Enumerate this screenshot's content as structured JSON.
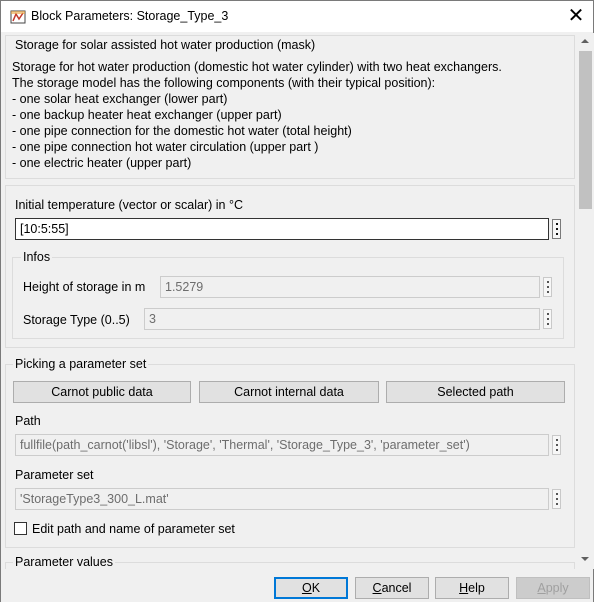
{
  "window": {
    "title": "Block Parameters: Storage_Type_3",
    "close_glyph": "✕"
  },
  "mask": {
    "title": "Storage for solar assisted hot water production (mask)",
    "description": [
      "Storage for hot water production (domestic hot water cylinder) with two heat exchangers.",
      "The storage model has the following components (with their typical position):",
      "- one solar heat exchanger (lower part)",
      "- one backup heater heat exchanger (upper part)",
      "- one pipe connection for the domestic hot water (total height)",
      "- one pipe connection hot water circulation (upper part )",
      "- one electric heater (upper part)"
    ]
  },
  "initial_temperature": {
    "label": "Initial temperature (vector or scalar) in °C",
    "value": "[10:5:55]"
  },
  "infos": {
    "title": "Infos",
    "height_label": "Height of storage in m",
    "height_value": "1.5279",
    "type_label": "Storage Type (0..5)",
    "type_value": "3"
  },
  "picking": {
    "title": "Picking a parameter set",
    "buttons": [
      "Carnot public data",
      "Carnot internal data",
      "Selected path"
    ],
    "path_label": "Path",
    "path_value": "fullfile(path_carnot('libsl'), 'Storage', 'Thermal', 'Storage_Type_3', 'parameter_set')",
    "parameter_set_label": "Parameter set",
    "parameter_set_value": "'StorageType3_300_L.mat'",
    "edit_checkbox_label": "Edit path and name of parameter set",
    "edit_checkbox_checked": false
  },
  "parameter_values": {
    "title": "Parameter values"
  },
  "dialog_buttons": {
    "ok_accel": "O",
    "ok_rest": "K",
    "cancel_accel": "C",
    "cancel_rest": "ancel",
    "help_accel": "H",
    "help_rest": "elp",
    "apply_accel": "A",
    "apply_rest": "pply"
  },
  "icons": {
    "window": "simulink-block-icon",
    "ellipsis": "vertical-ellipsis-icon"
  },
  "colors": {
    "accent": "#0078d7",
    "background": "#f0f0f0",
    "disabled_text": "#6d6d6d"
  }
}
